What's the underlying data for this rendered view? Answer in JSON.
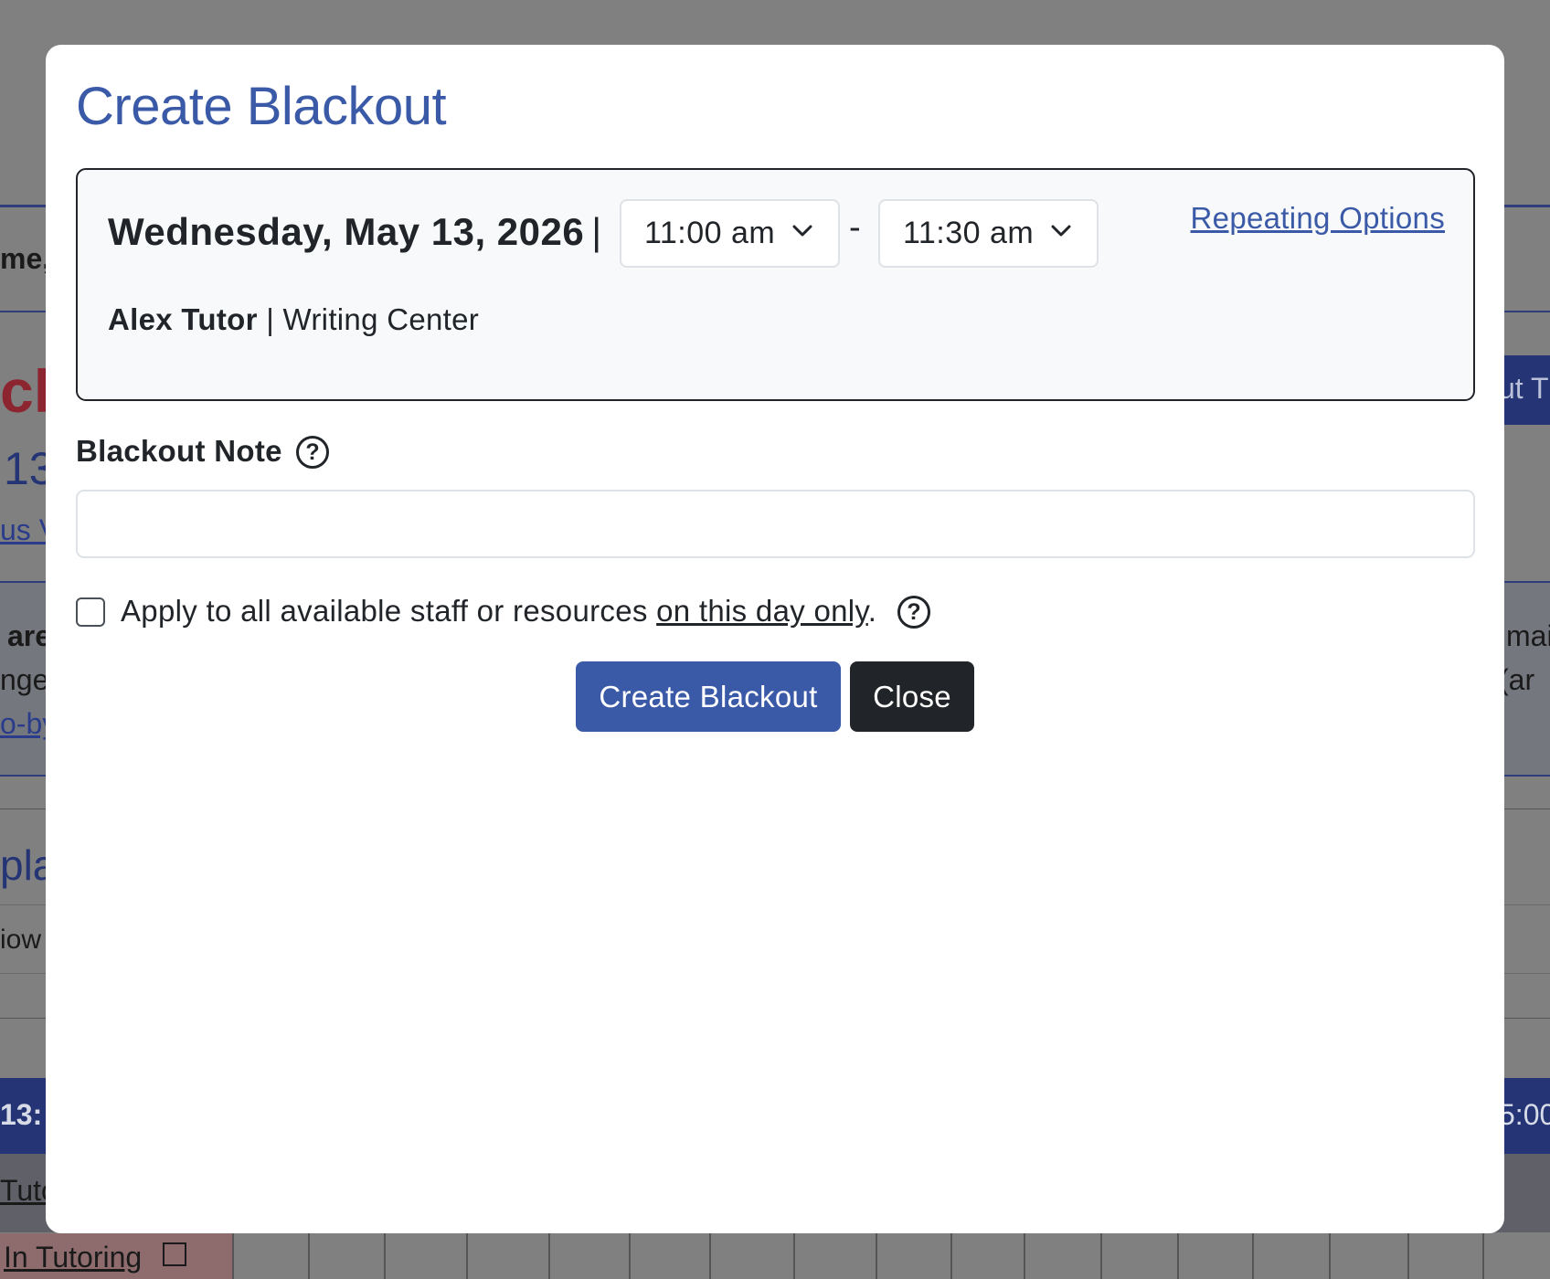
{
  "background": {
    "fragments": {
      "name_partial": "me,",
      "red_partial": "ck",
      "date_partial": "13",
      "link_partial_1": "us V",
      "bold_partial": "are",
      "text_partial_1": "nge",
      "link_partial_2": "o-by",
      "heading_partial": "pla",
      "row_partial": "iow",
      "time_left_partial": "13:",
      "link_partial_3": "Tuto",
      "cell_partial": "In Tutoring",
      "btn_partial_right": "ut T",
      "text_right_1": "mai",
      "text_right_2": "(ar",
      "time_right_partial": "5:00"
    }
  },
  "modal": {
    "title": "Create Blackout",
    "info": {
      "date": "Wednesday, May 13, 2026",
      "separator": "|",
      "start_time": "11:00 am",
      "time_dash": "-",
      "end_time": "11:30 am",
      "repeating_link": "Repeating Options",
      "tutor_name": "Alex Tutor",
      "tutor_separator": "|",
      "center": "Writing Center"
    },
    "note": {
      "label": "Blackout Note",
      "help": "?",
      "value": ""
    },
    "apply": {
      "text_before": "Apply to all available staff or resources ",
      "text_underlined": "on this day only",
      "text_after": ".",
      "help": "?",
      "checked": false
    },
    "buttons": {
      "create": "Create Blackout",
      "close": "Close"
    }
  },
  "colors": {
    "accent": "#3a5aa8",
    "dark": "#212529",
    "overlay": "#808080"
  }
}
